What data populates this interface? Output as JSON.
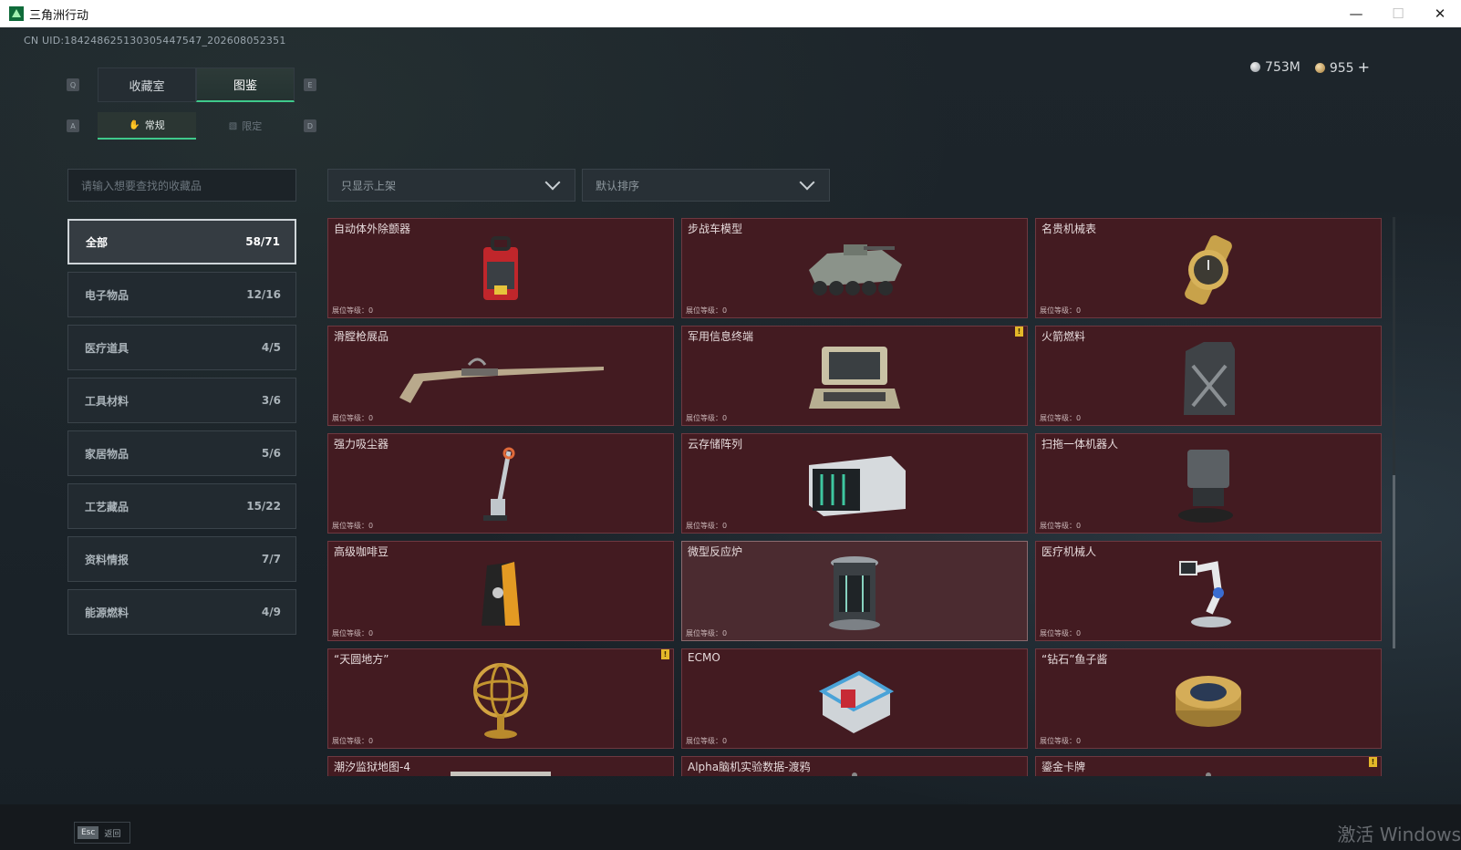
{
  "window": {
    "title": "三角洲行动",
    "minimize": "—",
    "maximize": "☐",
    "close": "✕"
  },
  "uid_text": "CN UID:18424862513030544754​7_202608052351",
  "key_hints": {
    "q": "Q",
    "e": "E",
    "a": "A",
    "d": "D"
  },
  "main_tabs": [
    {
      "label": "收藏室",
      "active": false
    },
    {
      "label": "图鉴",
      "active": true
    }
  ],
  "sub_tabs": [
    {
      "label": "常规",
      "active": true
    },
    {
      "label": "限定",
      "active": false
    }
  ],
  "currency": {
    "silver": "753M",
    "gold": "955",
    "plus": "+"
  },
  "search": {
    "placeholder": "请输入想要查找的收藏品"
  },
  "filters": {
    "shelf": "只显示上架",
    "sort": "默认排序"
  },
  "categories": [
    {
      "label": "全部",
      "count": "58/71",
      "active": true
    },
    {
      "label": "电子物品",
      "count": "12/16"
    },
    {
      "label": "医疗道具",
      "count": "4/5"
    },
    {
      "label": "工具材料",
      "count": "3/6"
    },
    {
      "label": "家居物品",
      "count": "5/6"
    },
    {
      "label": "工艺藏品",
      "count": "15/22"
    },
    {
      "label": "资料情报",
      "count": "7/7"
    },
    {
      "label": "能源燃料",
      "count": "4/9"
    }
  ],
  "level_label": "展位等级：0",
  "badge_text": "!",
  "items": [
    {
      "name": "自动体外除颤器",
      "icon": "defibrillator-icon"
    },
    {
      "name": "步战车模型",
      "icon": "ifv-model-icon"
    },
    {
      "name": "名贵机械表",
      "icon": "watch-icon"
    },
    {
      "name": "滑膛枪展品",
      "icon": "musket-icon"
    },
    {
      "name": "军用信息终端",
      "icon": "military-terminal-icon",
      "badge": true
    },
    {
      "name": "火箭燃料",
      "icon": "fuel-canister-icon"
    },
    {
      "name": "强力吸尘器",
      "icon": "vacuum-icon"
    },
    {
      "name": "云存储阵列",
      "icon": "storage-array-icon"
    },
    {
      "name": "扫拖一体机器人",
      "icon": "robot-mop-icon"
    },
    {
      "name": "高级咖啡豆",
      "icon": "coffee-bag-icon"
    },
    {
      "name": "微型反应炉",
      "icon": "reactor-icon",
      "highlight": true
    },
    {
      "name": "医疗机械人",
      "icon": "medical-robot-icon"
    },
    {
      "name": "“天圆地方”",
      "icon": "armillary-sphere-icon",
      "badge": true
    },
    {
      "name": "ECMO",
      "icon": "ecmo-icon"
    },
    {
      "name": "“钻石”鱼子酱",
      "icon": "caviar-tin-icon"
    },
    {
      "name": "潮汐监狱地图-4",
      "icon": "map-icon"
    },
    {
      "name": "Alpha脑机实验数据-渡鸦",
      "icon": "data-icon"
    },
    {
      "name": "鎏金卡牌",
      "icon": "gold-card-icon",
      "badge": true
    }
  ],
  "bottom": {
    "esc_key": "Esc",
    "esc_label": "返回",
    "watermark": "激活 Windows"
  }
}
